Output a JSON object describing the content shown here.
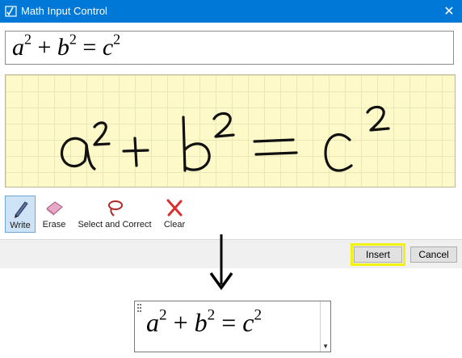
{
  "window": {
    "title": "Math Input Control",
    "app_icon": "math-input-app-icon",
    "close_glyph": "✕",
    "titlebar_color": "#0078d7"
  },
  "preview": {
    "base1": "a",
    "exp1": "2",
    "op1": "+",
    "base2": "b",
    "exp2": "2",
    "op2": "=",
    "base3": "c",
    "exp3": "2"
  },
  "writing_pad": {
    "background_color": "#fef9c8",
    "ink_icon": "handwritten-ink-strokes"
  },
  "toolbar": {
    "tools": [
      {
        "label": "Write",
        "icon": "pen-icon",
        "active": true
      },
      {
        "label": "Erase",
        "icon": "eraser-icon",
        "active": false
      },
      {
        "label": "Select and Correct",
        "icon": "lasso-icon",
        "active": false
      },
      {
        "label": "Clear",
        "icon": "clear-x-icon",
        "active": false
      }
    ]
  },
  "buttons": {
    "insert_label": "Insert",
    "cancel_label": "Cancel",
    "highlight_color": "#f2f20d"
  },
  "output": {
    "base1": "a",
    "exp1": "2",
    "op1": "+",
    "base2": "b",
    "exp2": "2",
    "op2": "=",
    "base3": "c",
    "exp3": "2",
    "dropdown_glyph": "▼"
  }
}
